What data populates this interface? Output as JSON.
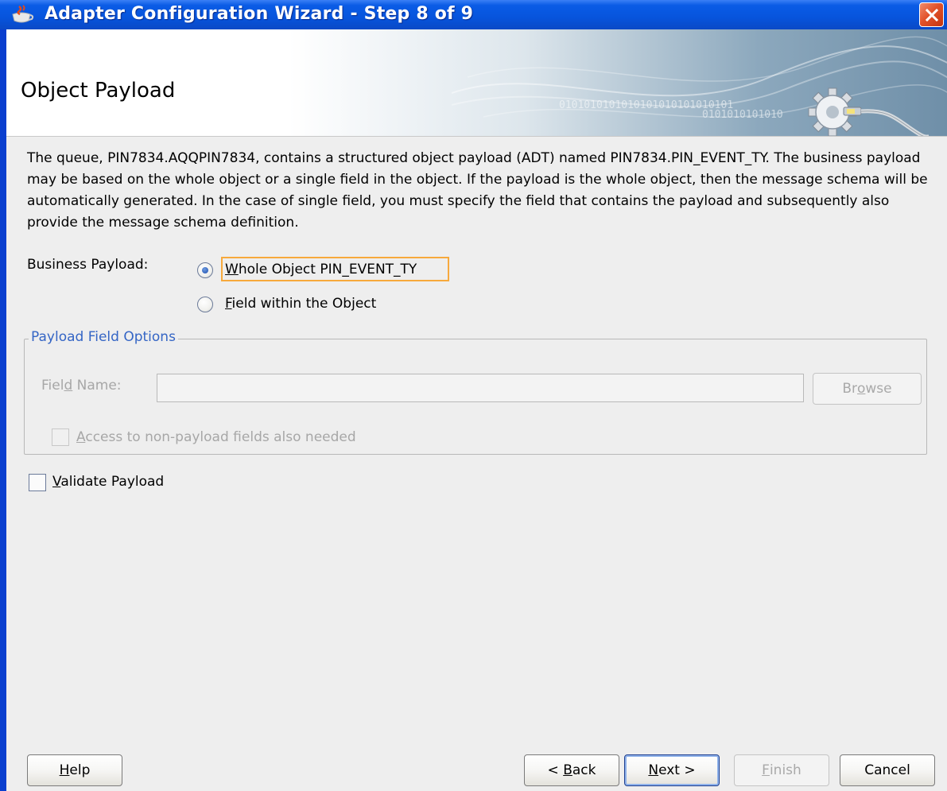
{
  "window": {
    "title": "Adapter Configuration Wizard - Step 8 of 9",
    "title_icon": "java-cup-icon",
    "close_icon": "close-x-icon"
  },
  "header": {
    "title": "Object Payload",
    "binary_line1": "0101010101010101010101010101",
    "binary_line2": "0101010101010",
    "logo": "gear-adapter-logo"
  },
  "description": "The queue, PIN7834.AQQPIN7834, contains a structured object payload (ADT) named PIN7834.PIN_EVENT_TY.  The business payload may be based on the whole object or a single field in the object. If the payload is the whole object, then the message schema will be automatically generated. In the case of single field, you must specify the field that contains the payload and subsequently also provide the message schema definition.",
  "business_payload": {
    "label": "Business Payload:",
    "options": [
      {
        "mnemonic": "W",
        "rest": "hole Object PIN_EVENT_TY",
        "selected": true
      },
      {
        "mnemonic": "F",
        "rest": "ield within the Object",
        "selected": false
      }
    ]
  },
  "payload_field_options": {
    "legend": "Payload Field Options",
    "field_name_label_pre": "Fiel",
    "field_name_label_mnemonic": "d",
    "field_name_label_post": " Name:",
    "field_name_value": "",
    "browse_pre": "Br",
    "browse_mnemonic": "o",
    "browse_post": "wse",
    "access_mnemonic": "A",
    "access_rest": "ccess to non-payload fields also needed",
    "access_checked": false
  },
  "validate": {
    "mnemonic": "V",
    "rest": "alidate Payload",
    "checked": false
  },
  "buttons": {
    "help_mnemonic": "H",
    "help_rest": "elp",
    "back_pre": "< ",
    "back_mnemonic": "B",
    "back_rest": "ack",
    "next_mnemonic": "N",
    "next_rest": "ext >",
    "finish_mnemonic": "F",
    "finish_rest": "inish",
    "cancel": "Cancel"
  },
  "colors": {
    "titlebar": "#0754dc",
    "focus": "#f7a93c",
    "legend": "#3465c5"
  }
}
